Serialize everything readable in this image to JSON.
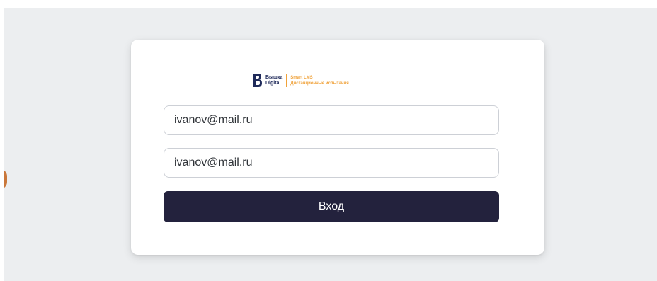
{
  "brand": {
    "name_line1": "Вышка",
    "name_line2": "Digital",
    "product_line1": "Smart LMS",
    "product_line2": "Дистанционные испытания",
    "colors": {
      "navy": "#1f2a5a",
      "accent": "#f0a23a"
    }
  },
  "form": {
    "field1_value": "ivanov@mail.ru",
    "field2_value": "ivanov@mail.ru",
    "submit_label": "Вход"
  },
  "colors": {
    "background": "#eceef0",
    "card": "#ffffff",
    "button": "#23223d",
    "field_border": "#cdd0d6"
  }
}
